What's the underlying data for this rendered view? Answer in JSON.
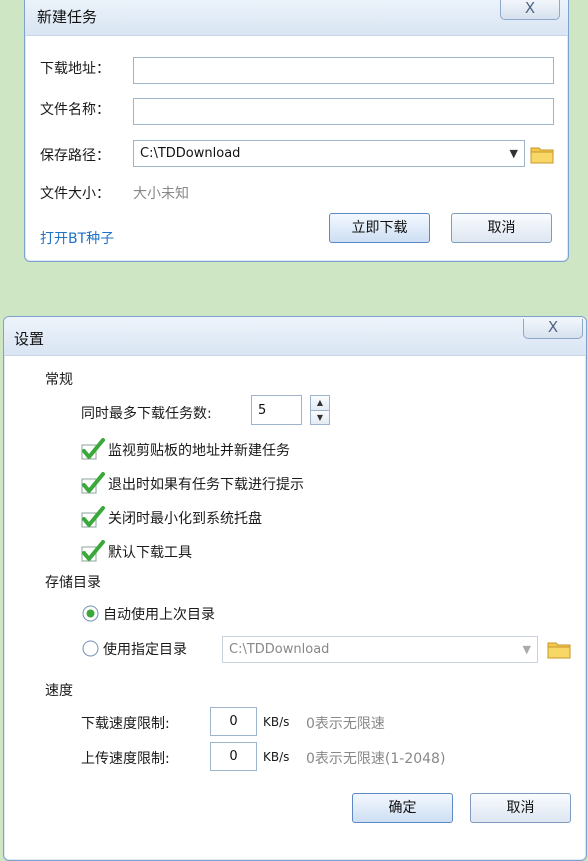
{
  "new_task": {
    "title": "新建任务",
    "close_label": "X",
    "url_label": "下载地址：",
    "url_value": "",
    "name_label": "文件名称：",
    "name_value": "",
    "path_label": "保存路径：",
    "path_value": "C:\\TDDownload",
    "size_label": "文件大小：",
    "size_value": "大小未知",
    "bt_link": "打开BT种子",
    "download_button": "立即下载",
    "cancel_button": "取消"
  },
  "settings": {
    "title": "设置",
    "close_label": "X",
    "general_heading": "常规",
    "max_tasks_label": "同时最多下载任务数:",
    "max_tasks_value": "5",
    "checkboxes": [
      {
        "label": "监视剪贴板的地址并新建任务",
        "checked": true
      },
      {
        "label": "退出时如果有任务下载进行提示",
        "checked": true
      },
      {
        "label": "关闭时最小化到系统托盘",
        "checked": true
      },
      {
        "label": "默认下载工具",
        "checked": true
      }
    ],
    "storage_heading": "存储目录",
    "radios": [
      {
        "label": "自动使用上次目录",
        "selected": true
      },
      {
        "label": "使用指定目录",
        "selected": false
      }
    ],
    "dir_value": "C:\\TDDownload",
    "speed_heading": "速度",
    "download_limit_label": "下载速度限制:",
    "download_limit_value": "0",
    "download_unit": "KB/s",
    "download_hint": "0表示无限速",
    "upload_limit_label": "上传速度限制:",
    "upload_limit_value": "0",
    "upload_unit": "KB/s",
    "upload_hint": "0表示无限速(1-2048)",
    "ok_button": "确定",
    "cancel_button": "取消"
  },
  "colors": {
    "background": "#cfe6c5",
    "link": "#1f72c4",
    "check_green": "#3aa83a"
  }
}
